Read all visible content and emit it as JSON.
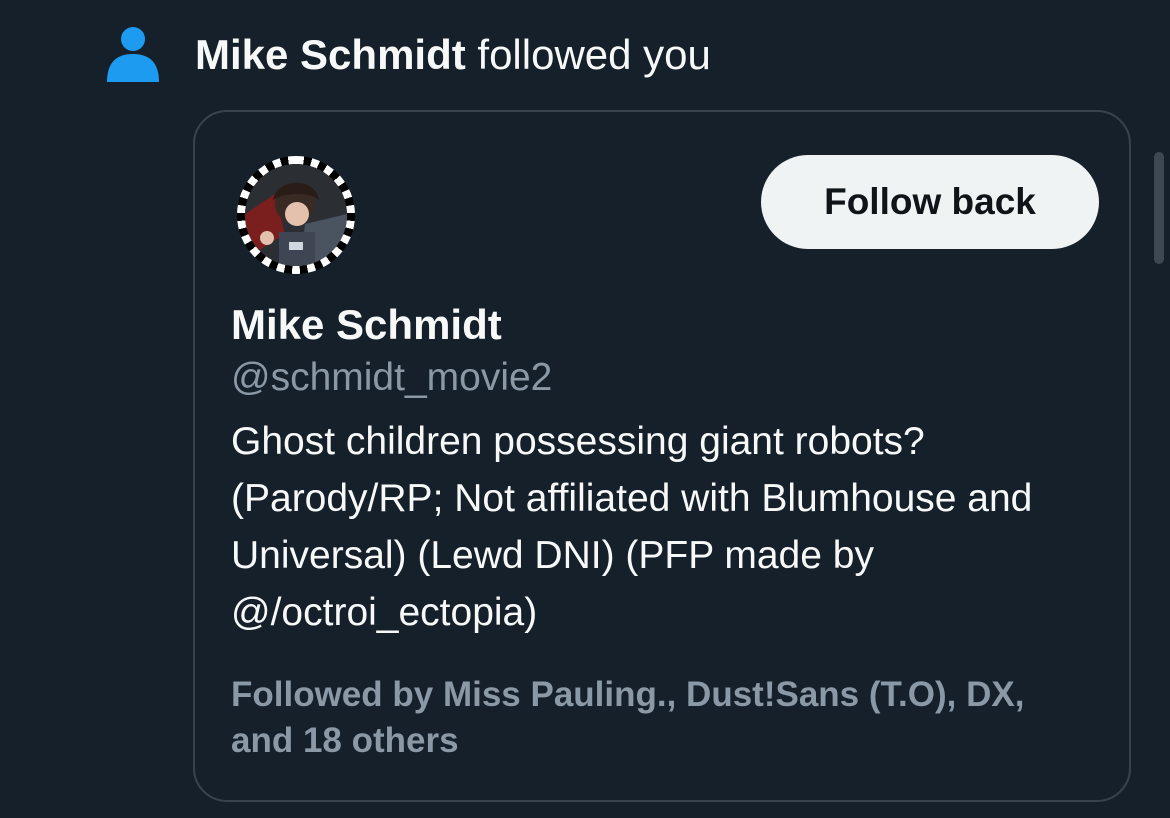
{
  "notification": {
    "icon": "person-icon",
    "name": "Mike Schmidt",
    "action": " followed you"
  },
  "profile": {
    "avatar": "avatar",
    "display_name": "Mike Schmidt",
    "handle": "@schmidt_movie2",
    "bio": "Ghost children possessing giant robots? (Parody/RP; Not affiliated with Blumhouse and Universal) (Lewd DNI) (PFP made by @/octroi_ectopia)",
    "followed_by": "Followed by Miss Pauling., Dust!Sans (T.O), DX, and 18 others",
    "follow_back_label": "Follow back"
  },
  "colors": {
    "background": "#15202b",
    "icon_blue": "#1d9bf0",
    "text_primary": "#f7f9f9",
    "text_secondary": "#8b98a5",
    "card_border": "#38444d",
    "button_bg": "#eff3f4"
  }
}
